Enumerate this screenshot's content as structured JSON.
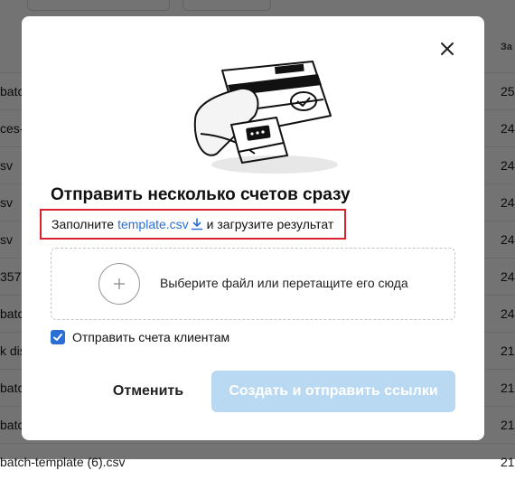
{
  "background": {
    "column_header": "За",
    "rows": [
      {
        "file": "batcl",
        "num": "25"
      },
      {
        "file": "ces-",
        "num": "24"
      },
      {
        "file": "sv",
        "num": "24"
      },
      {
        "file": "sv",
        "num": "24"
      },
      {
        "file": "sv",
        "num": "24"
      },
      {
        "file": "357",
        "num": "24"
      },
      {
        "file": "batc",
        "num": "24"
      },
      {
        "file": "k dis",
        "num": "21"
      },
      {
        "file": "batcl",
        "num": "21"
      },
      {
        "file": "batcl",
        "num": "21"
      },
      {
        "file": "batch-template (6).csv",
        "num": "21"
      }
    ]
  },
  "modal": {
    "title": "Отправить несколько счетов сразу",
    "hint_prefix": "Заполните",
    "hint_link": "template.csv",
    "hint_suffix": "и загрузите результат",
    "dropzone_text": "Выберите файл или перетащите его сюда",
    "checkbox_label": "Отправить счета клиентам",
    "checkbox_checked": true,
    "cancel_label": "Отменить",
    "submit_label": "Создать и отправить ссылки"
  },
  "colors": {
    "accent": "#2a6fd6",
    "submit_disabled_bg": "#b9d9f2",
    "highlight_border": "#d9232e"
  },
  "icons": [
    "close-icon",
    "download-icon",
    "plus-icon",
    "checkmark-icon"
  ]
}
